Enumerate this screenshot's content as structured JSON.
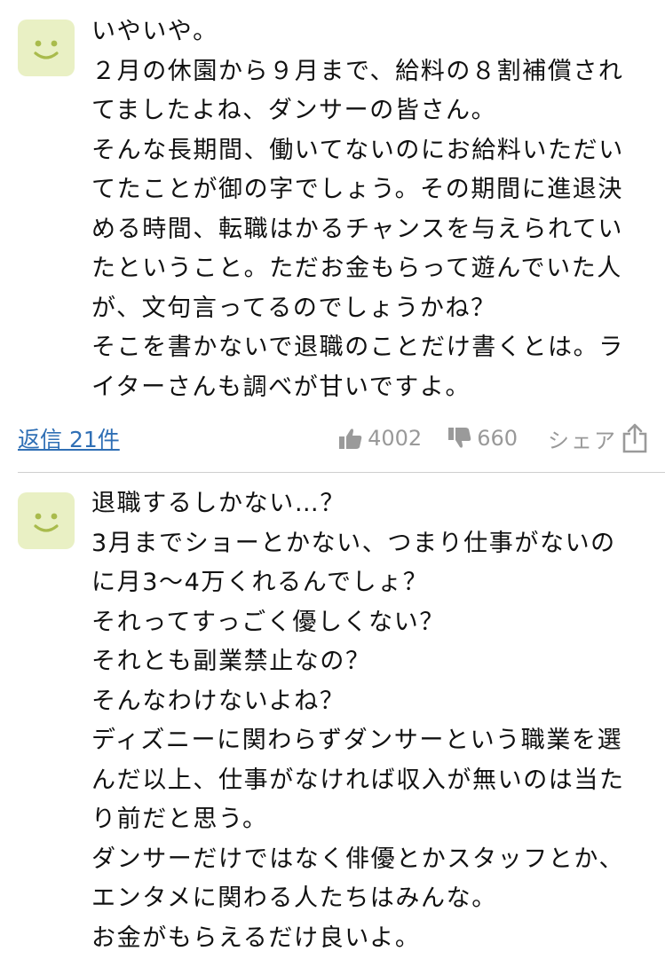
{
  "comments": [
    {
      "lines": [
        "いやいや。",
        "２月の休園から９月まで、給料の８割補償されて",
        "てましたよね、ダンサーの皆さん。",
        "そんな長期間、働いてないのにお給料いただい",
        "てたことが御の字でしょう。その期間に進退決",
        "める時間、転職はかるチャンスを与えられてい",
        "たということ。ただお金もらって遊んでいた人",
        "が、文句言ってるのでしょうかね？",
        "そこを書かないで退職のことだけ書くとは。ラ",
        "イターさんも調べが甘いですよ。"
      ],
      "reply_label": "返信 21件",
      "likes": "4002",
      "dislikes": "660",
      "share_label": "シェア"
    },
    {
      "lines": [
        "退職するしかない…？",
        "3月までショーとかない、つまり仕事がないの",
        "に月3〜4万くれるんでしょ？",
        "それってすっごく優しくない？",
        "それとも副業禁止なの？",
        "そんなわけないよね？",
        "ディズニーに関わらずダンサーという職業を選",
        "んだ以上、仕事がなければ収入が無いのは当た",
        "り前だと思う。",
        "ダンサーだけではなく俳優とかスタッフとか、",
        "エンタメに関わる人たちはみんな。",
        "お金がもらえるだけ良いよ。"
      ]
    }
  ],
  "colors": {
    "avatar_bg": "#e9f0c4",
    "avatar_face": "#a9bb4c",
    "link": "#2f6fb5",
    "meta": "#999999"
  },
  "icons": {
    "like": "thumbs-up-icon",
    "dislike": "thumbs-down-icon",
    "share": "share-icon",
    "avatar": "smiley-avatar-icon"
  }
}
